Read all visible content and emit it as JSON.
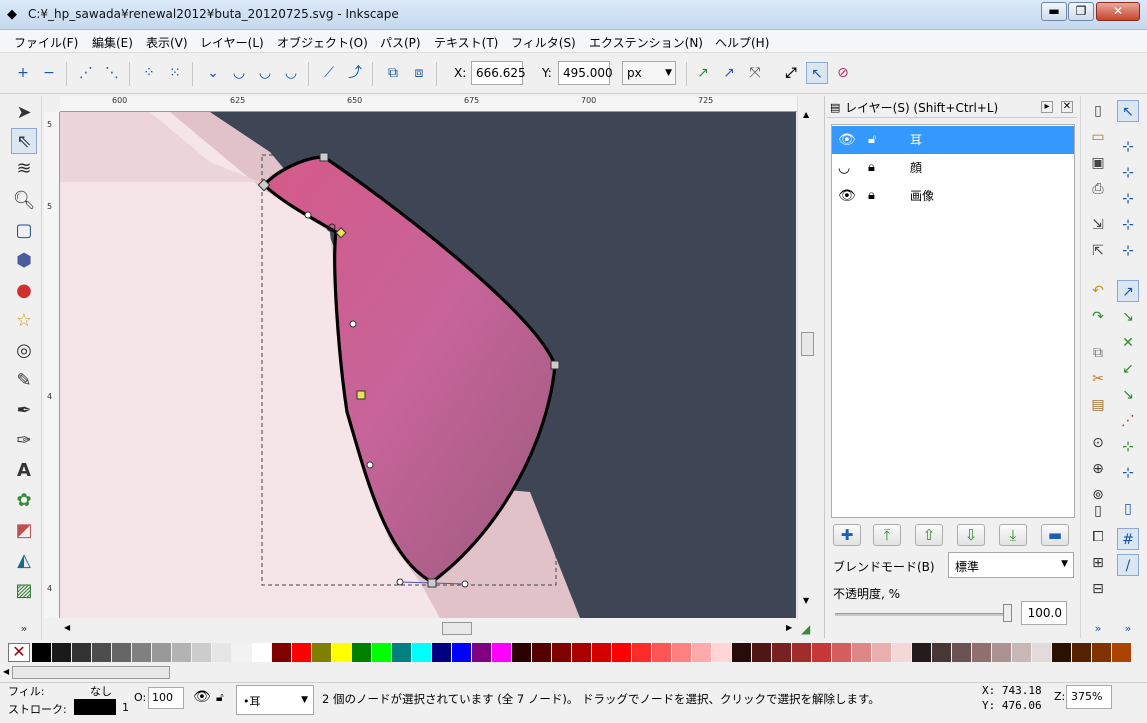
{
  "window": {
    "title": "C:¥_hp_sawada¥renewal2012¥buta_20120725.svg - Inkscape",
    "minimize": "▬",
    "maximize": "❐",
    "close": "✕"
  },
  "menu": [
    "ファイル(F)",
    "編集(E)",
    "表示(V)",
    "レイヤー(L)",
    "オブジェクト(O)",
    "パス(P)",
    "テキスト(T)",
    "フィルタ(S)",
    "エクステンション(N)",
    "ヘルプ(H)"
  ],
  "toolbar": {
    "x_label": "X:",
    "x_value": "666.625",
    "y_label": "Y:",
    "y_value": "495.000",
    "unit": "px"
  },
  "ruler": {
    "h": [
      "600",
      "625",
      "650",
      "675",
      "700",
      "725"
    ],
    "v": [
      "5",
      "5",
      "4",
      "4"
    ]
  },
  "layers_panel": {
    "title": "レイヤー(S) (Shift+Ctrl+L)",
    "layers": [
      {
        "name": "耳",
        "selected": true
      },
      {
        "name": "顔",
        "selected": false
      },
      {
        "name": "画像",
        "selected": false
      }
    ],
    "blend_label": "ブレンドモード(B)",
    "blend_value": "標準",
    "opacity_label": "不透明度, %",
    "opacity_value": "100.0"
  },
  "status": {
    "fill_label": "フィル:",
    "fill_value": "なし",
    "stroke_label": "ストローク:",
    "stroke_width": "1",
    "opacity_label": "O:",
    "opacity_value": "100",
    "layer_value": "•耳",
    "message": "2 個のノードが選択されています (全 7 ノード)。 ドラッグでノードを選択、クリックで選択を解除します。",
    "cursor_x": "X:  743.18",
    "cursor_y": "Y:  476.06",
    "zoom_label": "Z:",
    "zoom_value": "375%"
  },
  "palette_colors": [
    "#000000",
    "#1a1a1a",
    "#333333",
    "#4d4d4d",
    "#666666",
    "#808080",
    "#999999",
    "#b3b3b3",
    "#cccccc",
    "#e6e6e6",
    "#f2f2f2",
    "#ffffff",
    "#800000",
    "#ff0000",
    "#808000",
    "#ffff00",
    "#008000",
    "#00ff00",
    "#008080",
    "#00ffff",
    "#000080",
    "#0000ff",
    "#800080",
    "#ff00ff",
    "#2b0000",
    "#550000",
    "#800000",
    "#aa0000",
    "#d40000",
    "#ff0000",
    "#ff2a2a",
    "#ff5555",
    "#ff8080",
    "#ffaaaa",
    "#ffd5d5",
    "#280b0b",
    "#501616",
    "#782121",
    "#a02c2c",
    "#c83737",
    "#d35f5f",
    "#de8787",
    "#e9afaf",
    "#f4d7d7",
    "#241c1c",
    "#483737",
    "#6c5353",
    "#916f6f",
    "#ac9393",
    "#c8b7b7",
    "#e3dbdb",
    "#2b1100",
    "#552200",
    "#803300",
    "#aa4400"
  ]
}
